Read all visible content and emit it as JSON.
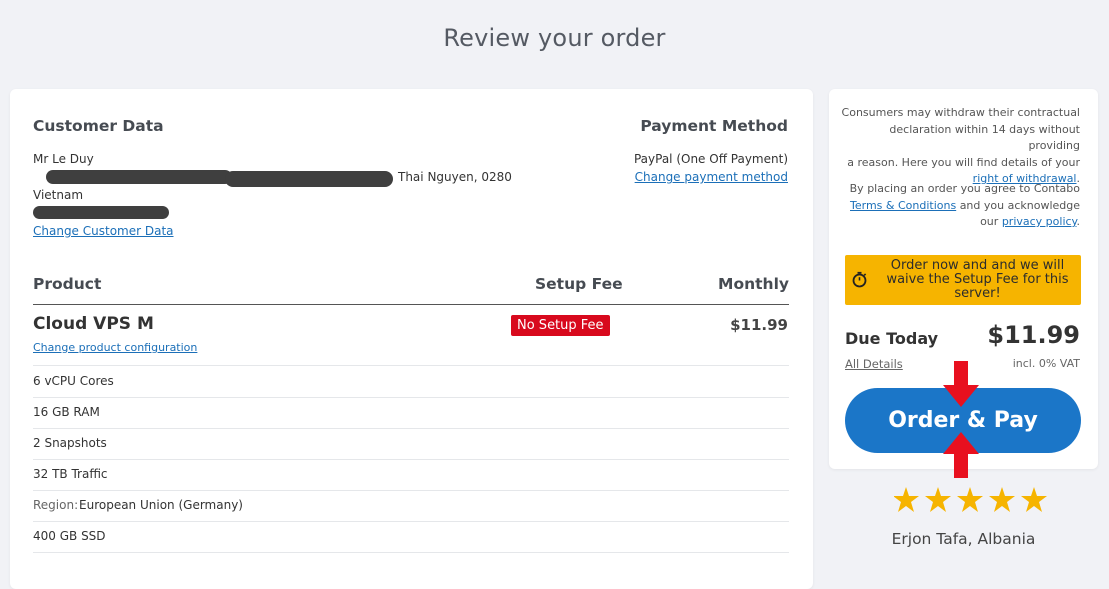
{
  "page": {
    "title": "Review your order"
  },
  "customer": {
    "heading": "Customer Data",
    "name": "Mr Le Duy",
    "address_visible": "Thai Nguyen, 0280",
    "country": "Vietnam",
    "change_link": "Change Customer Data"
  },
  "payment": {
    "heading": "Payment Method",
    "method": "PayPal (One Off Payment)",
    "change_link": "Change payment method"
  },
  "table": {
    "col_product": "Product",
    "col_setup": "Setup Fee",
    "col_monthly": "Monthly",
    "product_name": "Cloud VPS M",
    "change_config": "Change product configuration",
    "setup_badge": "No Setup Fee",
    "monthly_price": "$11.99",
    "features": [
      {
        "prefix": "",
        "text": "6 vCPU Cores"
      },
      {
        "prefix": "",
        "text": "16 GB RAM"
      },
      {
        "prefix": "",
        "text": "2 Snapshots"
      },
      {
        "prefix": "",
        "text": "32 TB Traffic"
      },
      {
        "prefix": "Region:",
        "text": "European Union (Germany)"
      },
      {
        "prefix": "",
        "text": "400 GB SSD"
      }
    ]
  },
  "sidebar": {
    "withdrawal_text_1": "Consumers may withdraw their contractual",
    "withdrawal_text_2": "declaration within 14 days without providing",
    "withdrawal_text_3": "a reason. Here you will find details of your",
    "withdrawal_link": "right of withdrawal",
    "terms_text_1": "By placing an order you agree to Contabo",
    "terms_link": "Terms & Conditions",
    "terms_text_2": "and you acknowledge",
    "terms_text_3": "our",
    "privacy_link": "privacy policy",
    "banner": "Order now and and we will waive the Setup Fee for this server!",
    "due_label": "Due Today",
    "due_amount": "$11.99",
    "all_details": "All Details",
    "vat": "incl. 0% VAT",
    "pay_button": "Order & Pay"
  },
  "review": {
    "stars": 5,
    "reviewer": "Erjon Tafa, Albania"
  },
  "colors": {
    "accent": "#1b76c8",
    "badge": "#d8091d",
    "banner": "#f6b400",
    "star": "#f6b400",
    "arrow": "#e8101f"
  }
}
